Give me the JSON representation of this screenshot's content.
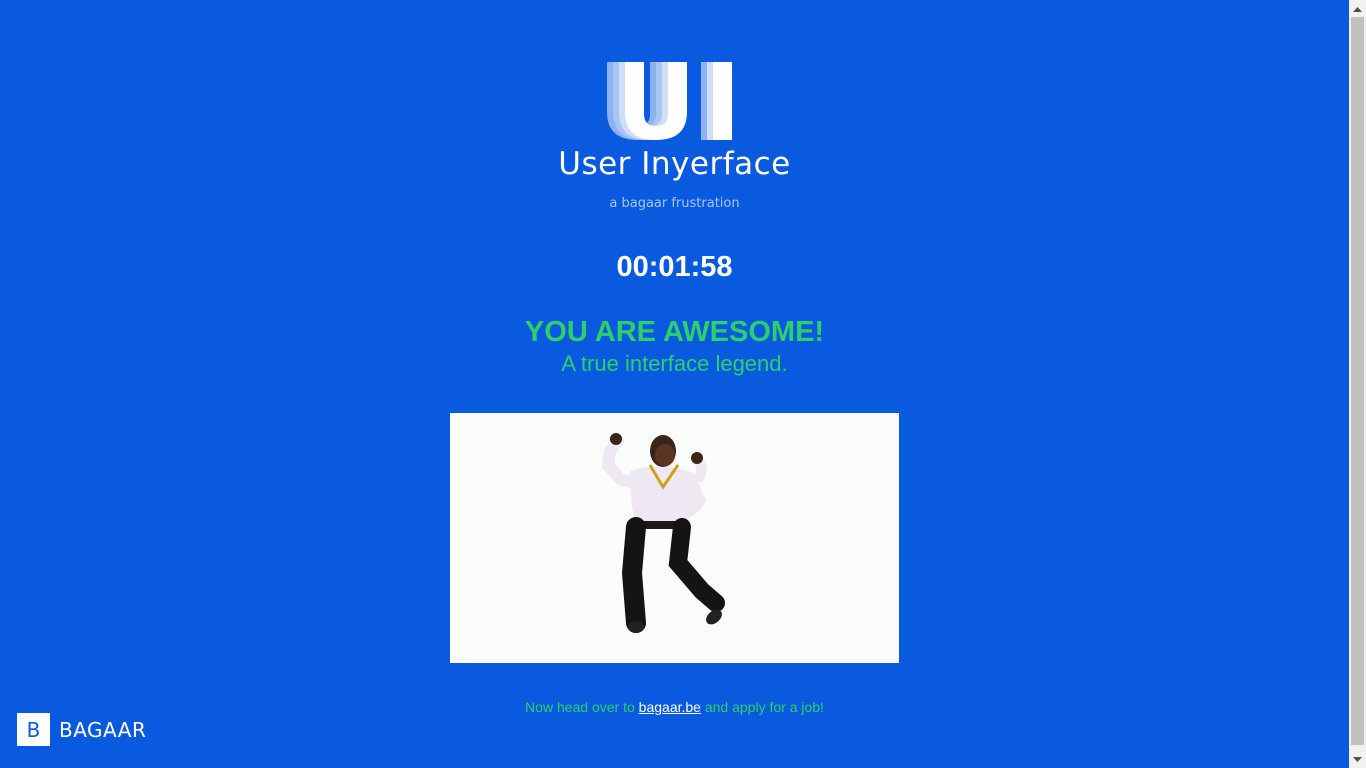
{
  "app": {
    "logo_text": "UI",
    "title": "User Inyerface",
    "subtitle": "a bagaar frustration"
  },
  "timer": {
    "value": "00:01:58"
  },
  "result": {
    "headline": "YOU ARE AWESOME!",
    "subheadline": "A true interface legend."
  },
  "footer": {
    "text_before": "Now head over to ",
    "link_text": "bagaar.be",
    "text_after": " and apply for a job!"
  },
  "brand": {
    "mark": "B",
    "name": "BAGAAR"
  },
  "colors": {
    "background": "#0a5ae0",
    "accent": "#2ccf6a",
    "text": "#ffffff"
  }
}
